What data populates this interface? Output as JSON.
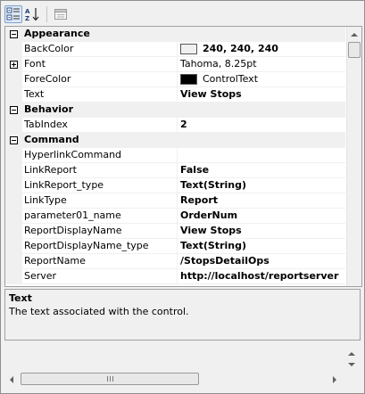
{
  "toolbar": {
    "categorized_icon": "categorized-icon",
    "alphabetical_icon": "alphabetical-sort-icon",
    "property_pages_icon": "property-pages-icon"
  },
  "grid": {
    "categories": [
      {
        "label": "Appearance",
        "expanded": true,
        "properties": [
          {
            "name": "BackColor",
            "value": "240, 240, 240",
            "bold": true,
            "swatch": "#f0f0f0"
          },
          {
            "name": "Font",
            "value": "Tahoma, 8.25pt",
            "bold": false,
            "expandable": true
          },
          {
            "name": "ForeColor",
            "value": "ControlText",
            "bold": false,
            "swatch": "#000000"
          },
          {
            "name": "Text",
            "value": "View Stops",
            "bold": true
          }
        ]
      },
      {
        "label": "Behavior",
        "expanded": true,
        "properties": [
          {
            "name": "TabIndex",
            "value": "2",
            "bold": true
          }
        ]
      },
      {
        "label": "Command",
        "expanded": true,
        "properties": [
          {
            "name": "HyperlinkCommand",
            "value": "",
            "bold": false
          },
          {
            "name": "LinkReport",
            "value": "False",
            "bold": true
          },
          {
            "name": "LinkReport_type",
            "value": "Text(String)",
            "bold": true
          },
          {
            "name": "LinkType",
            "value": "Report",
            "bold": true
          },
          {
            "name": "parameter01_name",
            "value": "OrderNum",
            "bold": true
          },
          {
            "name": "ReportDisplayName",
            "value": "View Stops",
            "bold": true
          },
          {
            "name": "ReportDisplayName_type",
            "value": "Text(String)",
            "bold": true
          },
          {
            "name": "ReportName",
            "value": "/StopsDetailOps",
            "bold": true
          },
          {
            "name": "Server",
            "value": "http://localhost/reportserver",
            "bold": true
          }
        ]
      }
    ]
  },
  "description": {
    "title": "Text",
    "text": "The text associated with the control."
  },
  "colors": {
    "background": "#f0f0f0",
    "selected_toolbar": "#dde8f5",
    "grid_line": "#f0f0f0"
  }
}
